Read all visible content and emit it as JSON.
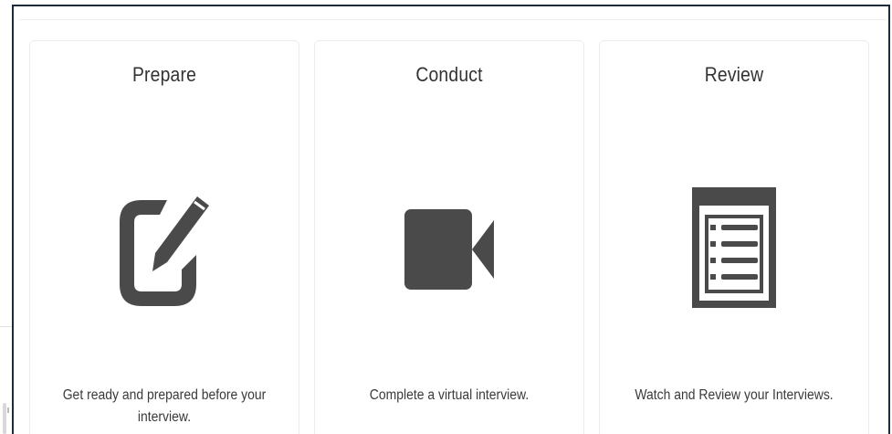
{
  "cards": [
    {
      "title": "Prepare",
      "icon": "edit-icon",
      "description": "Get ready and prepared before your interview."
    },
    {
      "title": "Conduct",
      "icon": "video-camera-icon",
      "description": "Complete a virtual interview."
    },
    {
      "title": "Review",
      "icon": "list-icon",
      "description": "Watch and Review your Interviews."
    }
  ],
  "colors": {
    "icon": "#4a4a4a",
    "text": "#333333",
    "card_border": "#ececec",
    "frame_border": "#1c2c3c"
  }
}
